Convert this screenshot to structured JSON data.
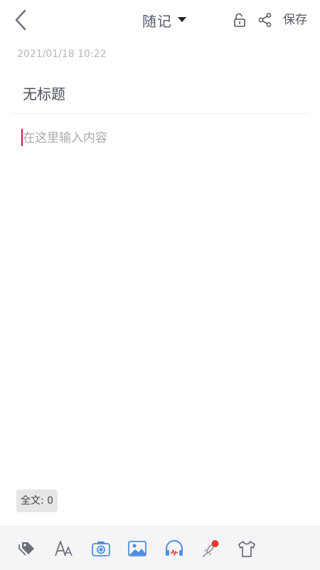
{
  "header": {
    "category_label": "随记",
    "save_label": "保存"
  },
  "note": {
    "timestamp": "2021/01/18 10:22",
    "title": "无标题",
    "content_placeholder": "在这里输入内容",
    "content_value": ""
  },
  "footer": {
    "word_count_label": "全文: 0"
  },
  "icons": {
    "back": "chevron-left-icon",
    "category_caret": "caret-down-icon",
    "lock": "unlock-icon",
    "share": "share-icon",
    "toolbar": [
      "tag-icon",
      "font-size-icon",
      "camera-icon",
      "image-icon",
      "audio-icon",
      "rocket-icon",
      "tshirt-icon"
    ]
  },
  "colors": {
    "accent_blue": "#4a90e2",
    "cursor": "#c2185b",
    "badge_red": "#e53935",
    "text_gray": "#555a6a"
  }
}
